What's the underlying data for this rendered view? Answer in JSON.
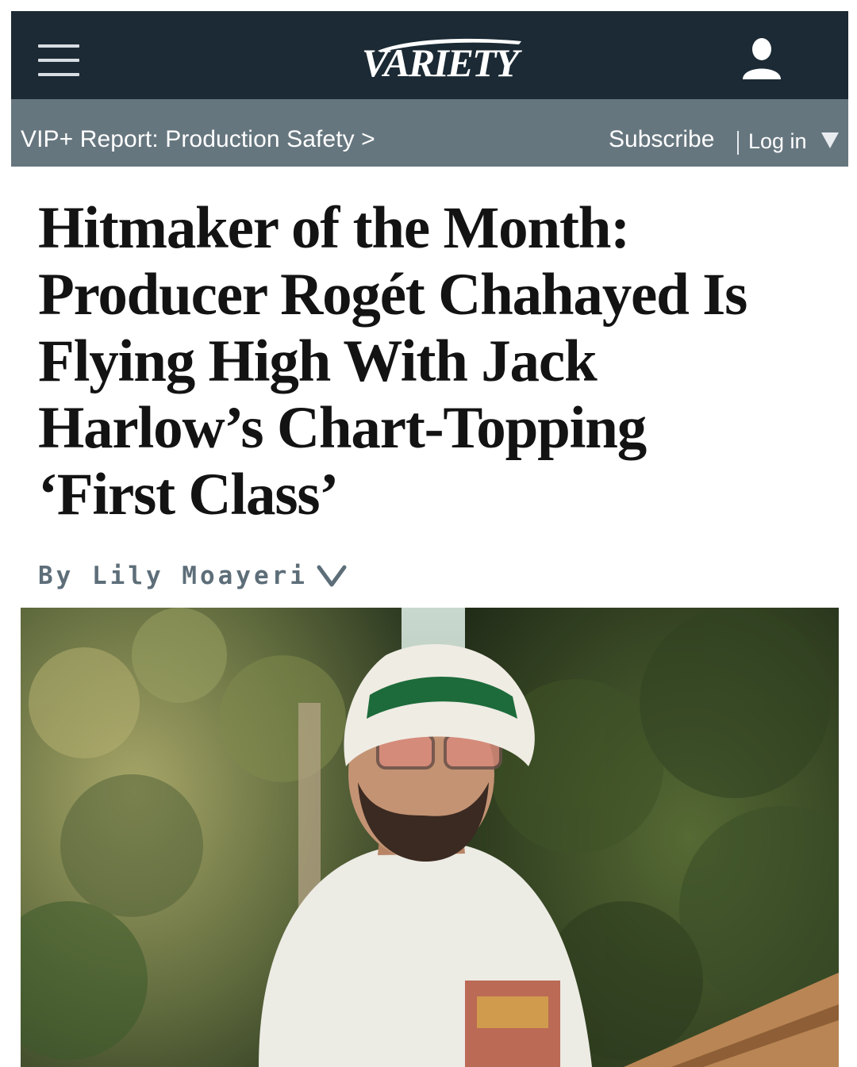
{
  "header": {
    "logo_text": "VARIETY",
    "menu_icon": "hamburger-menu-icon",
    "account_icon": "user-icon"
  },
  "subnav": {
    "vip_link": "VIP+ Report: Production Safety >",
    "subscribe": "Subscribe",
    "login": "Log in",
    "login_caret_icon": "caret-down-icon"
  },
  "article": {
    "headline_lines": [
      "Hitmaker of the Month:",
      "Producer Rogét Chahayed Is",
      "Flying High With Jack",
      "Harlow’s Chart-Topping",
      "‘First Class’"
    ],
    "byline": "By Lily Moayeri",
    "byline_icon": "chevron-down-icon"
  },
  "colors": {
    "topbar": "#1b2a34",
    "subbar": "#66767f",
    "byline": "#5d6e79",
    "headline": "#131313"
  }
}
